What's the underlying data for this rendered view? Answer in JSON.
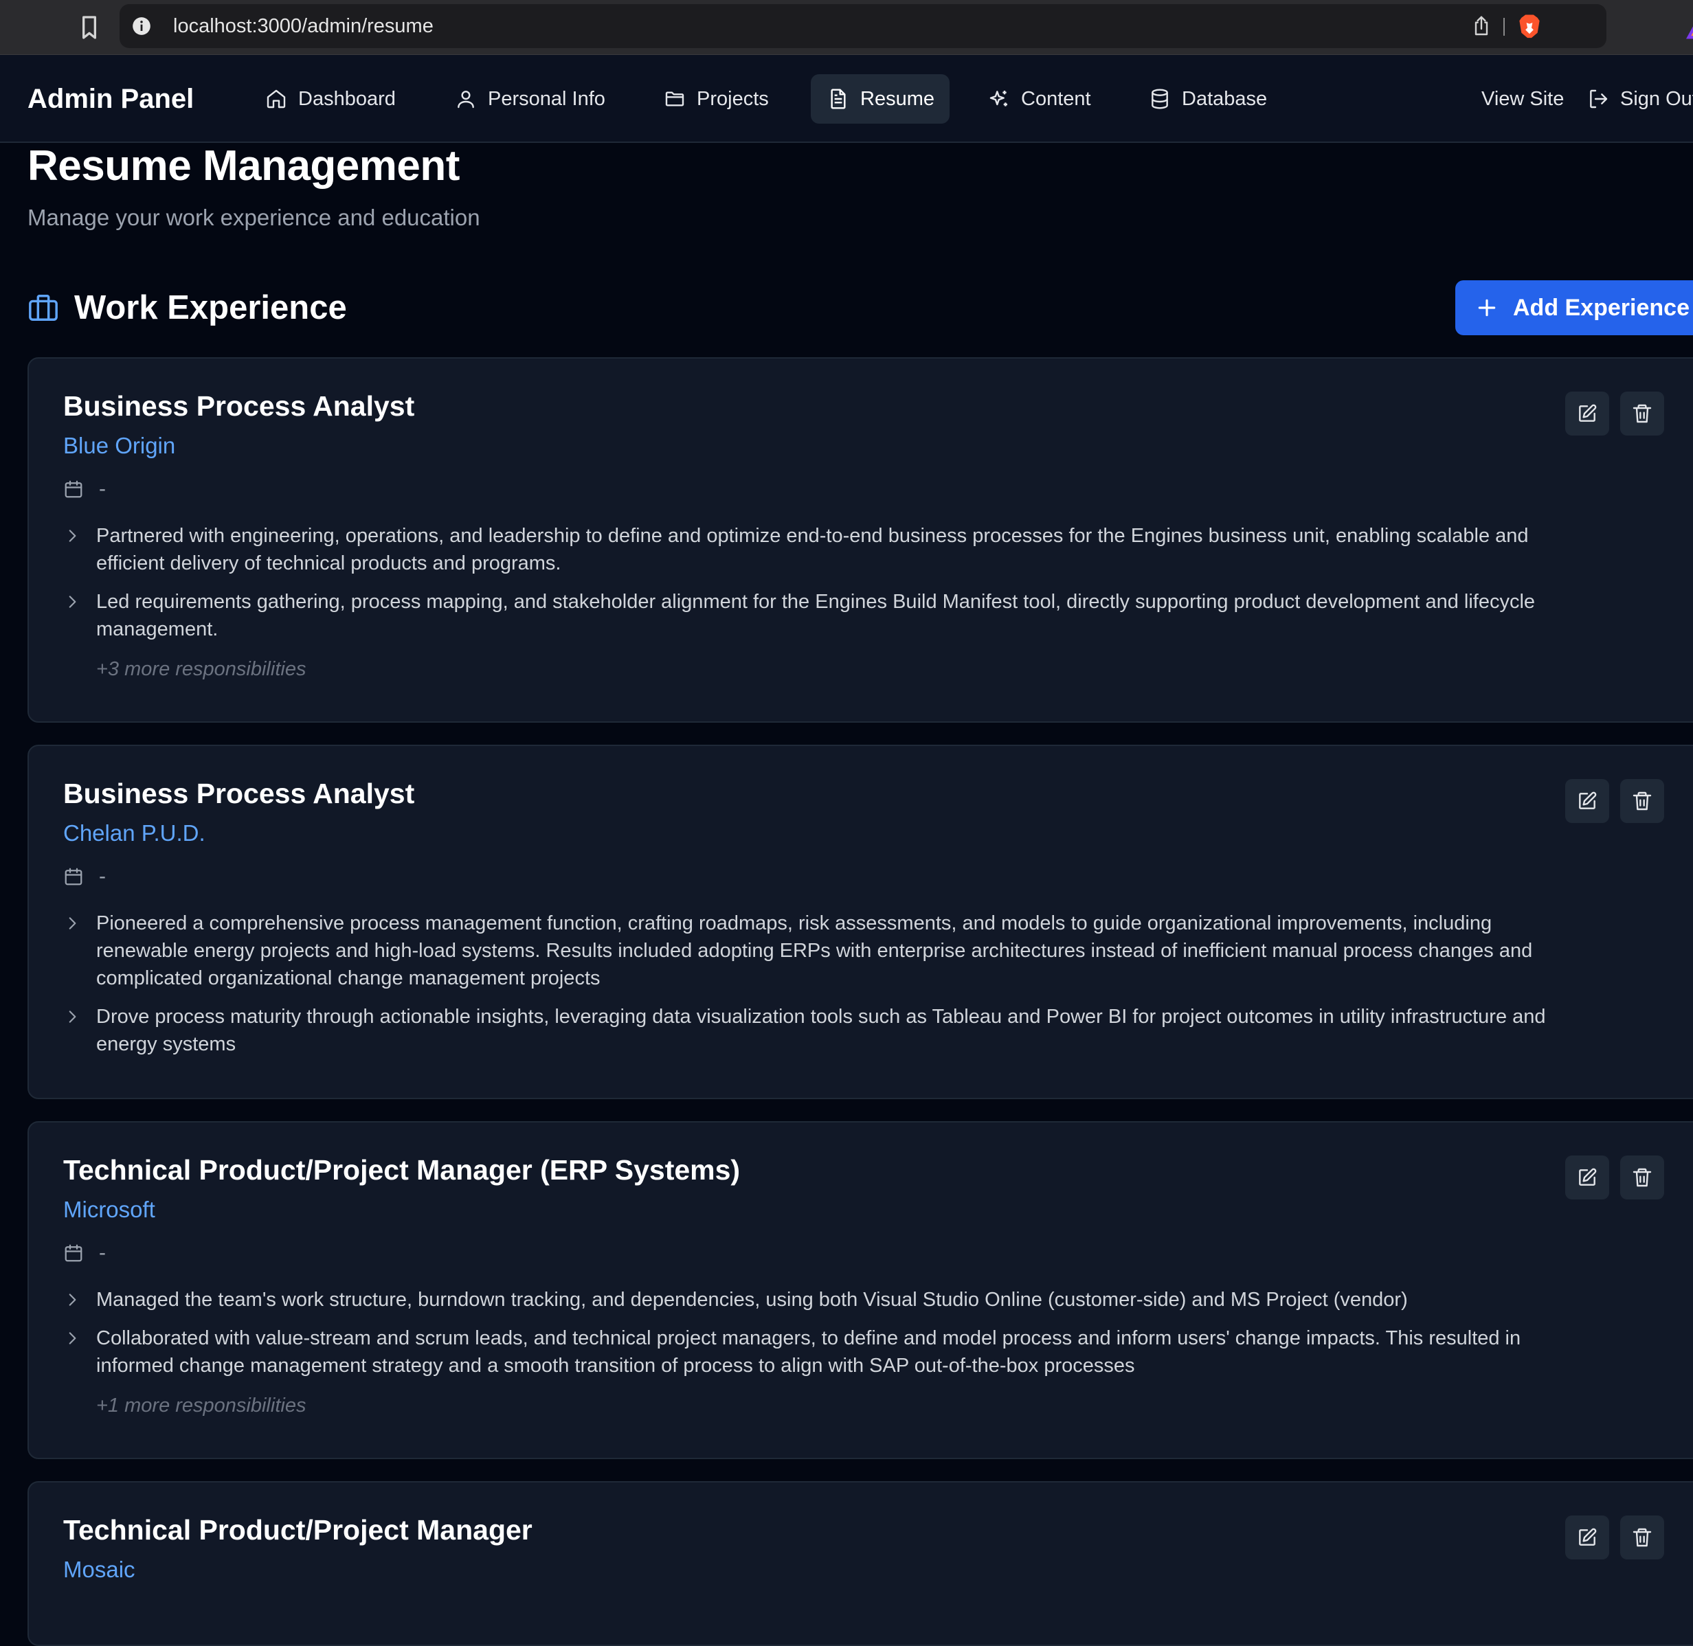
{
  "browser": {
    "url": "localhost:3000/admin/resume"
  },
  "header": {
    "brand": "Admin Panel",
    "nav": [
      {
        "label": "Dashboard",
        "icon": "home-icon"
      },
      {
        "label": "Personal Info",
        "icon": "user-icon"
      },
      {
        "label": "Projects",
        "icon": "folder-icon"
      },
      {
        "label": "Resume",
        "icon": "file-text-icon",
        "active": true
      },
      {
        "label": "Content",
        "icon": "sparkles-icon"
      },
      {
        "label": "Database",
        "icon": "database-icon"
      }
    ],
    "view_site": "View Site",
    "sign_out": "Sign Out"
  },
  "page": {
    "title": "Resume Management",
    "subtitle": "Manage your work experience and education"
  },
  "work_experience": {
    "heading": "Work Experience",
    "add_button": "Add Experience",
    "entries": [
      {
        "title": "Business Process Analyst",
        "company": "Blue Origin",
        "dates": "-",
        "responsibilities": [
          "Partnered with engineering, operations, and leadership to define and optimize end-to-end business processes for the Engines business unit, enabling scalable and efficient delivery of technical products and programs.",
          "Led requirements gathering, process mapping, and stakeholder alignment for the Engines Build Manifest tool, directly supporting product development and lifecycle management."
        ],
        "more": "+3 more responsibilities"
      },
      {
        "title": "Business Process Analyst",
        "company": "Chelan P.U.D.",
        "dates": "-",
        "responsibilities": [
          "Pioneered a comprehensive process management function, crafting roadmaps, risk assessments, and models to guide organizational improvements, including renewable energy projects and high-load systems. Results included adopting ERPs with enterprise architectures instead of inefficient manual process changes and complicated organizational change management projects",
          "Drove process maturity through actionable insights, leveraging data visualization tools such as Tableau and Power BI for project outcomes in utility infrastructure and energy systems"
        ],
        "more": ""
      },
      {
        "title": "Technical Product/Project Manager (ERP Systems)",
        "company": "Microsoft",
        "dates": "-",
        "responsibilities": [
          "Managed the team's work structure, burndown tracking, and dependencies, using both Visual Studio Online (customer-side) and MS Project (vendor)",
          "Collaborated with value-stream and scrum leads, and technical project managers, to define and model process and inform users' change impacts. This resulted in informed change management strategy and a smooth transition of process to align with SAP out-of-the-box processes"
        ],
        "more": "+1 more responsibilities"
      },
      {
        "title": "Technical Product/Project Manager",
        "company": "Mosaic",
        "dates": "",
        "responsibilities": [],
        "more": ""
      }
    ]
  },
  "colors": {
    "background": "#030712",
    "card": "#111827",
    "accent": "#2563eb",
    "company_link": "#60a5fa"
  }
}
